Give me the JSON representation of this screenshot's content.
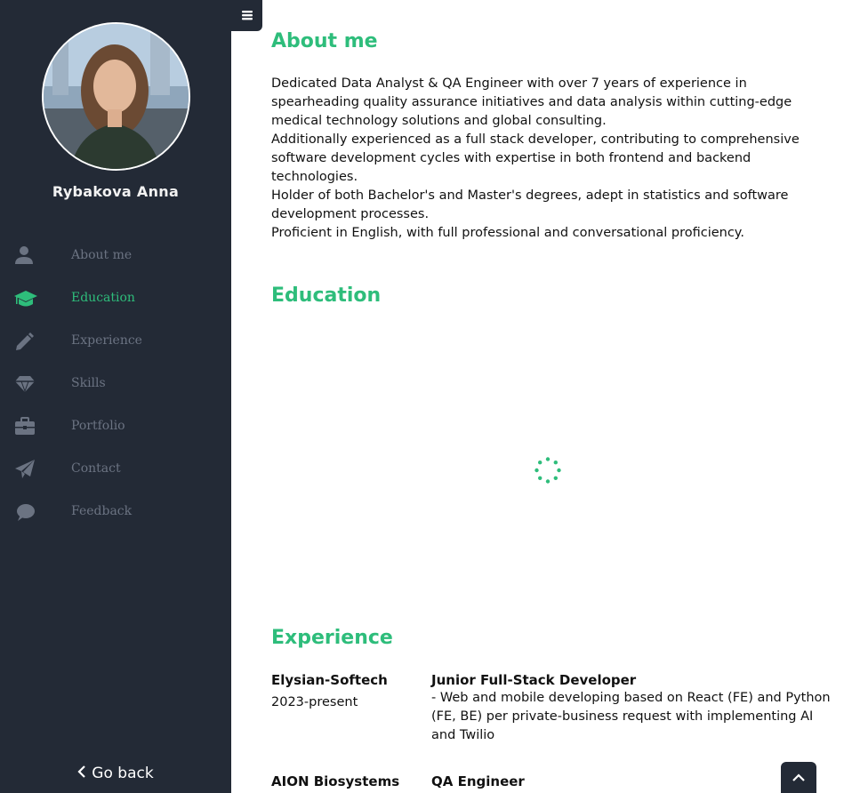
{
  "profile": {
    "name": "Rybakova Anna",
    "avatar_icon": "profile-photo"
  },
  "sidebar": {
    "toggle_icon": "hamburger-icon",
    "items": [
      {
        "label": "About me",
        "icon": "user-icon",
        "active": false
      },
      {
        "label": "Education",
        "icon": "graduation-cap-icon",
        "active": true
      },
      {
        "label": "Experience",
        "icon": "pencil-icon",
        "active": false
      },
      {
        "label": "Skills",
        "icon": "diamond-icon",
        "active": false
      },
      {
        "label": "Portfolio",
        "icon": "briefcase-icon",
        "active": false
      },
      {
        "label": "Contact",
        "icon": "paper-plane-icon",
        "active": false
      },
      {
        "label": "Feedback",
        "icon": "comment-icon",
        "active": false
      }
    ],
    "go_back": "Go back"
  },
  "about": {
    "title": "About me",
    "paragraphs": [
      "Dedicated Data Analyst & QA Engineer with over 7 years of experience in spearheading quality assurance initiatives and data analysis within cutting-edge medical technology solutions and global consulting.",
      "Additionally experienced as a full stack developer, contributing to comprehensive software development cycles with expertise in both frontend and backend technologies.",
      "Holder of both Bachelor's and Master's degrees, adept in statistics and software development processes.",
      "Proficient in English, with full professional and conversational proficiency."
    ]
  },
  "education": {
    "title": "Education",
    "loading_icon": "spinner-icon"
  },
  "experience": {
    "title": "Experience",
    "entries": [
      {
        "company": "Elysian-Softech",
        "period": "2023-present",
        "role": "Junior Full-Stack Developer",
        "description": "- Web and mobile developing based on React (FE) and Python (FE, BE) per private-business request with implementing AI and Twilio"
      },
      {
        "company": "AION Biosystems",
        "period": "",
        "role": "QA Engineer",
        "description": ""
      }
    ]
  },
  "colors": {
    "accent": "#2ebd7b",
    "sidebar_bg": "#232a36",
    "nav_muted": "#6b7382"
  }
}
